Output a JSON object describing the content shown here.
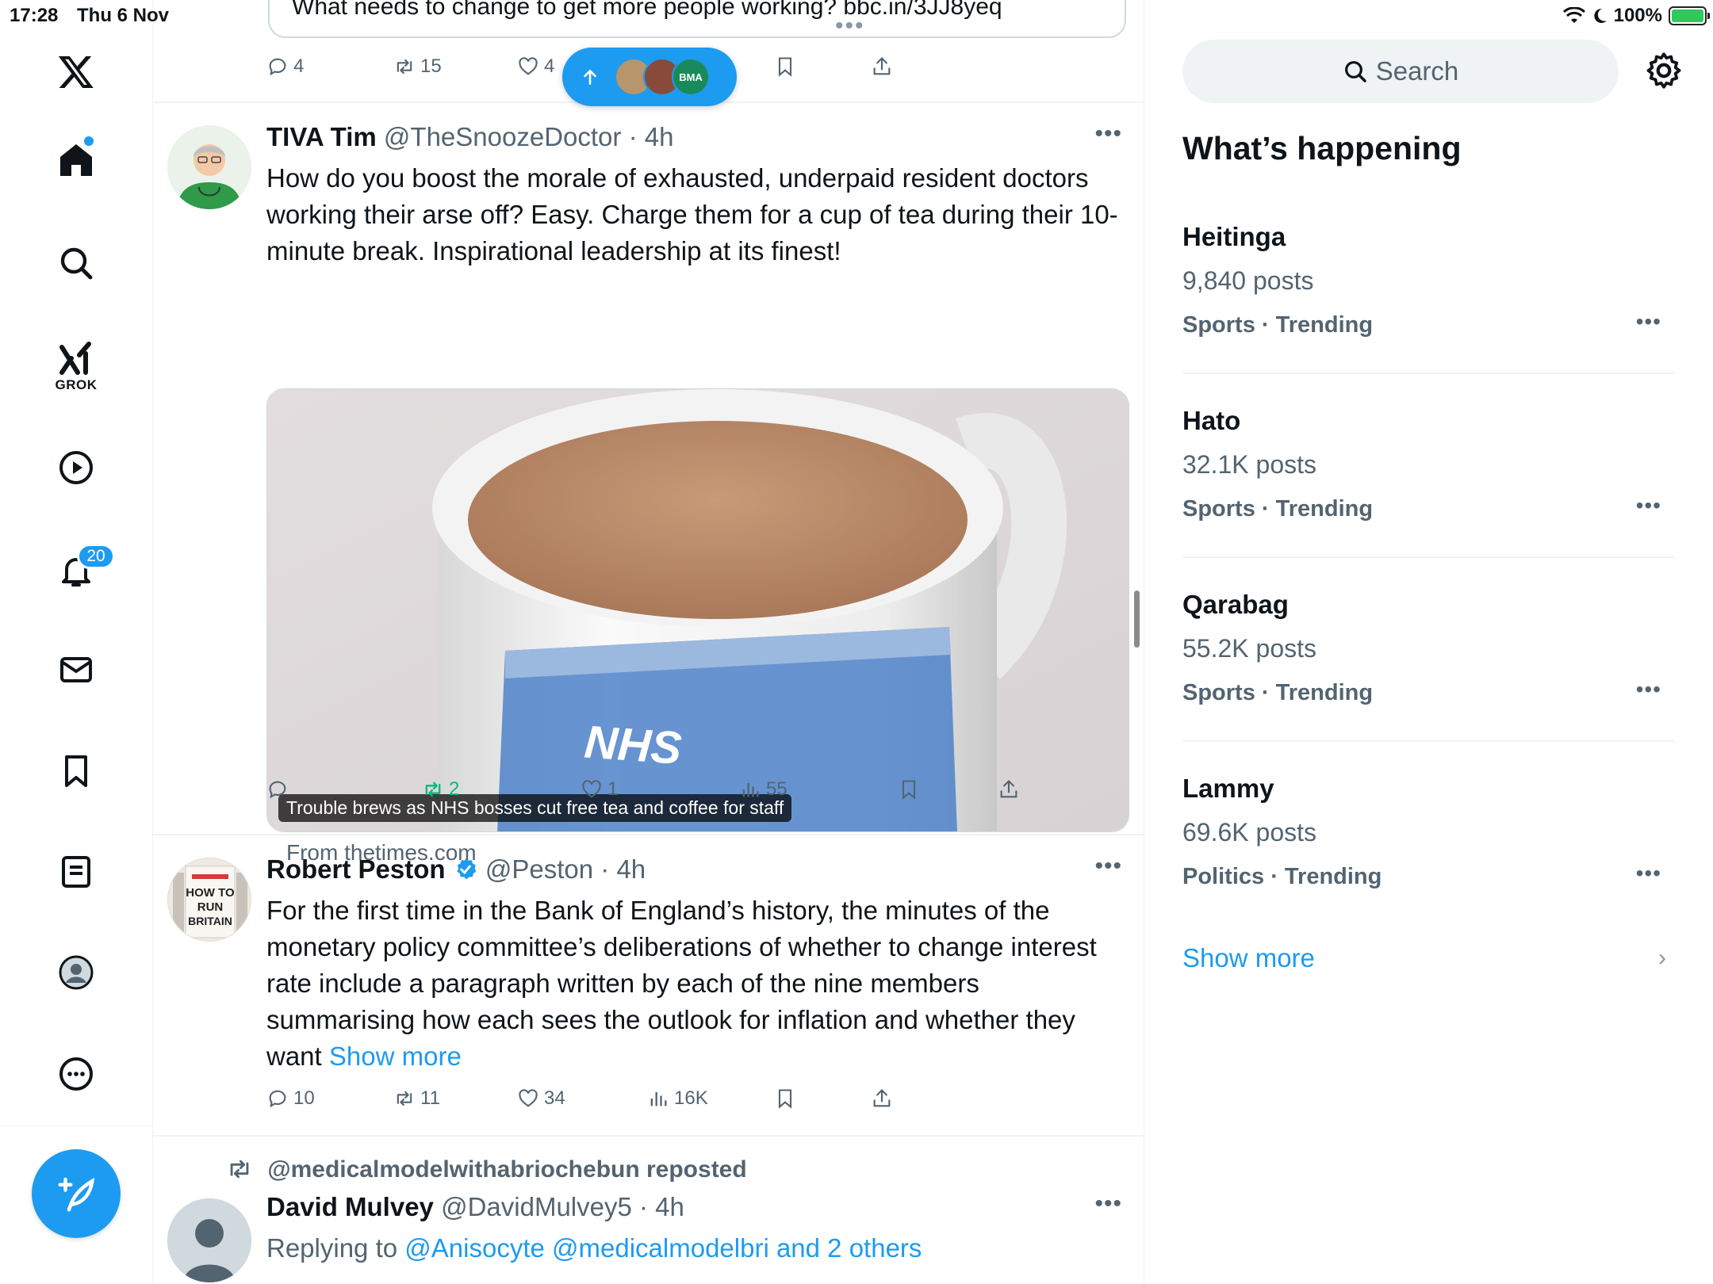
{
  "status_bar": {
    "time": "17:28",
    "date": "Thu 6 Nov",
    "battery": "100%"
  },
  "nav": {
    "grok_label": "GROK",
    "notifications_count": "20"
  },
  "top_partial": {
    "text": "What needs to change to get more people working? bbc.in/3JJ8yeq",
    "actions": {
      "replies": "4",
      "reposts": "15",
      "likes": "4"
    }
  },
  "new_posts_pill": {
    "avatar_label": "BMA"
  },
  "posts": [
    {
      "name": "TIVA Tim",
      "handle": "@TheSnoozeDoctor",
      "time": "· 4h",
      "text": "How do you boost the morale of exhausted, underpaid resident doctors working their arse off? Easy. Charge them for a cup of tea during their 10-minute break. Inspirational leadership at its finest!",
      "card_caption": "Trouble brews as NHS bosses cut free tea and coffee for staff",
      "card_mug_text": "NHS",
      "card_source": "From thetimes.com",
      "actions": {
        "replies": "",
        "reposts": "2",
        "likes": "1",
        "views": "55"
      }
    },
    {
      "name": "Robert Peston",
      "handle": "@Peston",
      "time": "· 4h",
      "text": "For the first time in the Bank of England’s history, the minutes of the monetary policy committee’s deliberations of whether to change interest rate include a paragraph written by each of the nine members summarising how each sees the outlook for inflation and whether they want",
      "show_more": "Show more",
      "avatar_text": "HOW TO RUN BRITAIN",
      "actions": {
        "replies": "10",
        "reposts": "11",
        "likes": "34",
        "views": "16K"
      }
    },
    {
      "repost_label": "@medicalmodelwithabriochebun reposted",
      "name": "David Mulvey",
      "handle": "@DavidMulvey5",
      "time": "· 4h",
      "replying_prefix": "Replying to",
      "replying_to": "@Anisocyte @medicalmodelbri and 2 others"
    }
  ],
  "sidebar": {
    "search_placeholder": "Search",
    "whats_happening": "What’s happening",
    "trends": [
      {
        "name": "Heitinga",
        "count": "9,840 posts",
        "category": "Sports · Trending"
      },
      {
        "name": "Hato",
        "count": "32.1K posts",
        "category": "Sports · Trending"
      },
      {
        "name": "Qarabag",
        "count": "55.2K posts",
        "category": "Sports · Trending"
      },
      {
        "name": "Lammy",
        "count": "69.6K posts",
        "category": "Politics · Trending"
      }
    ],
    "show_more": "Show more"
  },
  "colors": {
    "accent": "#1d9bf0",
    "muted": "#536471",
    "repost_green": "#00ba7c"
  }
}
